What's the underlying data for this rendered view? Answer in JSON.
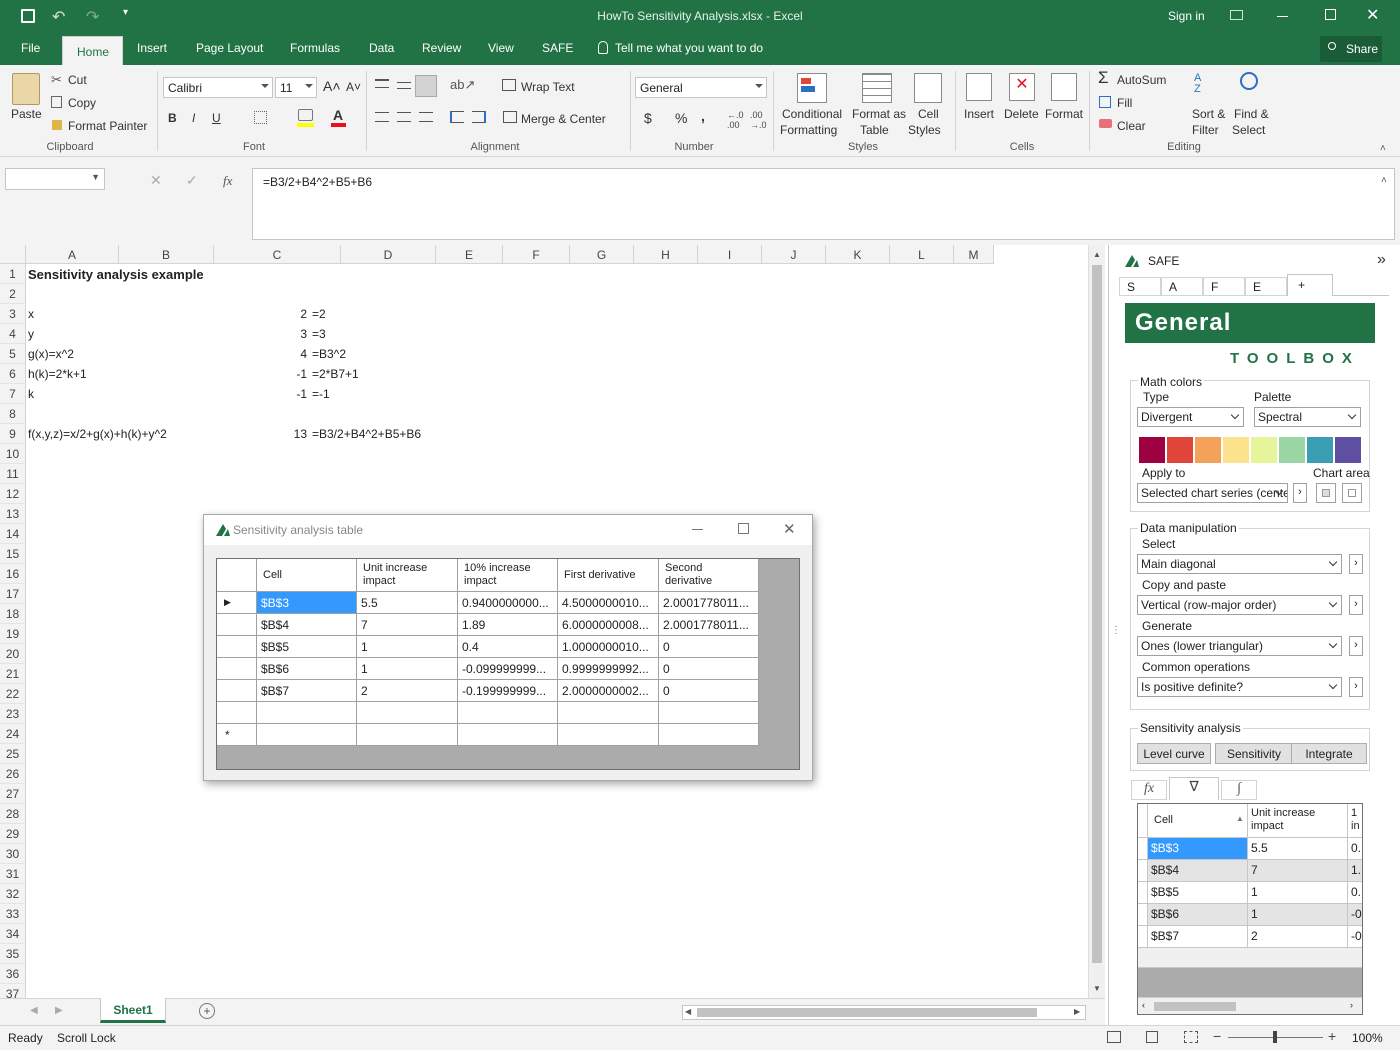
{
  "window": {
    "title": "HowTo Sensitivity Analysis.xlsx - Excel",
    "signin": "Sign in",
    "share": "Share"
  },
  "tabs": [
    "File",
    "Home",
    "Insert",
    "Page Layout",
    "Formulas",
    "Data",
    "Review",
    "View",
    "SAFE"
  ],
  "tellme": "Tell me what you want to do",
  "ribbon": {
    "clipboard": {
      "paste": "Paste",
      "cut": "Cut",
      "copy": "Copy",
      "format_painter": "Format Painter",
      "label": "Clipboard"
    },
    "font": {
      "name": "Calibri",
      "size": "11",
      "bold": "B",
      "italic": "I",
      "underline": "U",
      "label": "Font"
    },
    "alignment": {
      "wrap": "Wrap Text",
      "merge": "Merge & Center",
      "label": "Alignment"
    },
    "number": {
      "format": "General",
      "dollar": "$",
      "percent": "%",
      "comma": ",",
      "label": "Number"
    },
    "styles": {
      "conditional": "Conditional",
      "conditional2": "Formatting",
      "format_table": "Format as",
      "format_table2": "Table",
      "cell_styles": "Cell",
      "cell_styles2": "Styles",
      "label": "Styles"
    },
    "cells": {
      "insert": "Insert",
      "delete": "Delete",
      "format": "Format",
      "label": "Cells"
    },
    "editing": {
      "autosum": "AutoSum",
      "fill": "Fill",
      "clear": "Clear",
      "sort": "Sort &",
      "sort2": "Filter",
      "find": "Find &",
      "find2": "Select",
      "label": "Editing"
    }
  },
  "formula_bar": {
    "fx": "fx",
    "formula": "=B3/2+B4^2+B5+B6"
  },
  "columns": [
    "A",
    "B",
    "C",
    "D",
    "E",
    "F",
    "G",
    "H",
    "I",
    "J",
    "K",
    "L",
    "M"
  ],
  "rows": [
    "1",
    "2",
    "3",
    "4",
    "5",
    "6",
    "7",
    "8",
    "9",
    "10",
    "11",
    "12",
    "13",
    "14",
    "15",
    "16",
    "17",
    "18",
    "19",
    "20",
    "21",
    "22",
    "23",
    "24",
    "25",
    "26",
    "27",
    "28",
    "29",
    "30",
    "31",
    "32",
    "33",
    "34",
    "35",
    "36",
    "37"
  ],
  "cells": {
    "a1": "Sensitivity analysis example",
    "a3": "x",
    "b3": "2",
    "c3": "=2",
    "a4": "y",
    "b4": "3",
    "c4": "=3",
    "a5": "g(x)=x^2",
    "b5": "4",
    "c5": "=B3^2",
    "a6": "h(k)=2*k+1",
    "b6": "-1",
    "c6": "=2*B7+1",
    "a7": "k",
    "b7": "-1",
    "c7": "=-1",
    "a9": "f(x,y,z)=x/2+g(x)+h(k)+y^2",
    "b9": "13",
    "c9": "=B3/2+B4^2+B5+B6"
  },
  "sheet_tab": "Sheet1",
  "status": {
    "ready": "Ready",
    "scroll_lock": "Scroll Lock",
    "zoom": "100%"
  },
  "dialog": {
    "title": "Sensitivity analysis table",
    "headers": [
      "Cell",
      "Unit increase impact",
      "10% increase impact",
      "First derivative",
      "Second derivative"
    ],
    "rows": [
      [
        "$B$3",
        "5.5",
        "0.9400000000...",
        "4.5000000010...",
        "2.0001778011..."
      ],
      [
        "$B$4",
        "7",
        "1.89",
        "6.0000000008...",
        "2.0001778011..."
      ],
      [
        "$B$5",
        "1",
        "0.4",
        "1.0000000010...",
        "0"
      ],
      [
        "$B$6",
        "1",
        "-0.099999999...",
        "0.9999999992...",
        "0"
      ],
      [
        "$B$7",
        "2",
        "-0.199999999...",
        "2.0000000002...",
        "0"
      ]
    ],
    "new_row_marker": "*"
  },
  "pane": {
    "title": "SAFE",
    "tabs": [
      "S",
      "A",
      "F",
      "E",
      "+"
    ],
    "banner": "General",
    "toolbox": "TOOLBOX",
    "math_colors": "Math colors",
    "type_label": "Type",
    "type_value": "Divergent",
    "palette_label": "Palette",
    "palette_value": "Spectral",
    "swatches": [
      "#9e0142",
      "#e0453a",
      "#f4a259",
      "#fde28e",
      "#e6f49a",
      "#9ad6a4",
      "#3a9fb4",
      "#5e4fa2"
    ],
    "apply_to": "Apply to",
    "chart_area": "Chart area",
    "apply_value": "Selected chart series (cente",
    "data_manip": "Data manipulation",
    "select_label": "Select",
    "select_value": "Main diagonal",
    "copy_label": "Copy and paste",
    "copy_value": "Vertical (row-major order)",
    "generate_label": "Generate",
    "generate_value": "Ones (lower triangular)",
    "common_label": "Common operations",
    "common_value": "Is positive definite?",
    "sens_label": "Sensitivity analysis",
    "btn_level": "Level curve",
    "btn_sens": "Sensitivity",
    "btn_integrate": "Integrate",
    "mini_headers": [
      "Cell",
      "Unit increase impact",
      "1 in"
    ],
    "mini_rows": [
      [
        "$B$3",
        "5.5",
        "0."
      ],
      [
        "$B$4",
        "7",
        "1."
      ],
      [
        "$B$5",
        "1",
        "0."
      ],
      [
        "$B$6",
        "1",
        "-0"
      ],
      [
        "$B$7",
        "2",
        "-0"
      ]
    ]
  }
}
